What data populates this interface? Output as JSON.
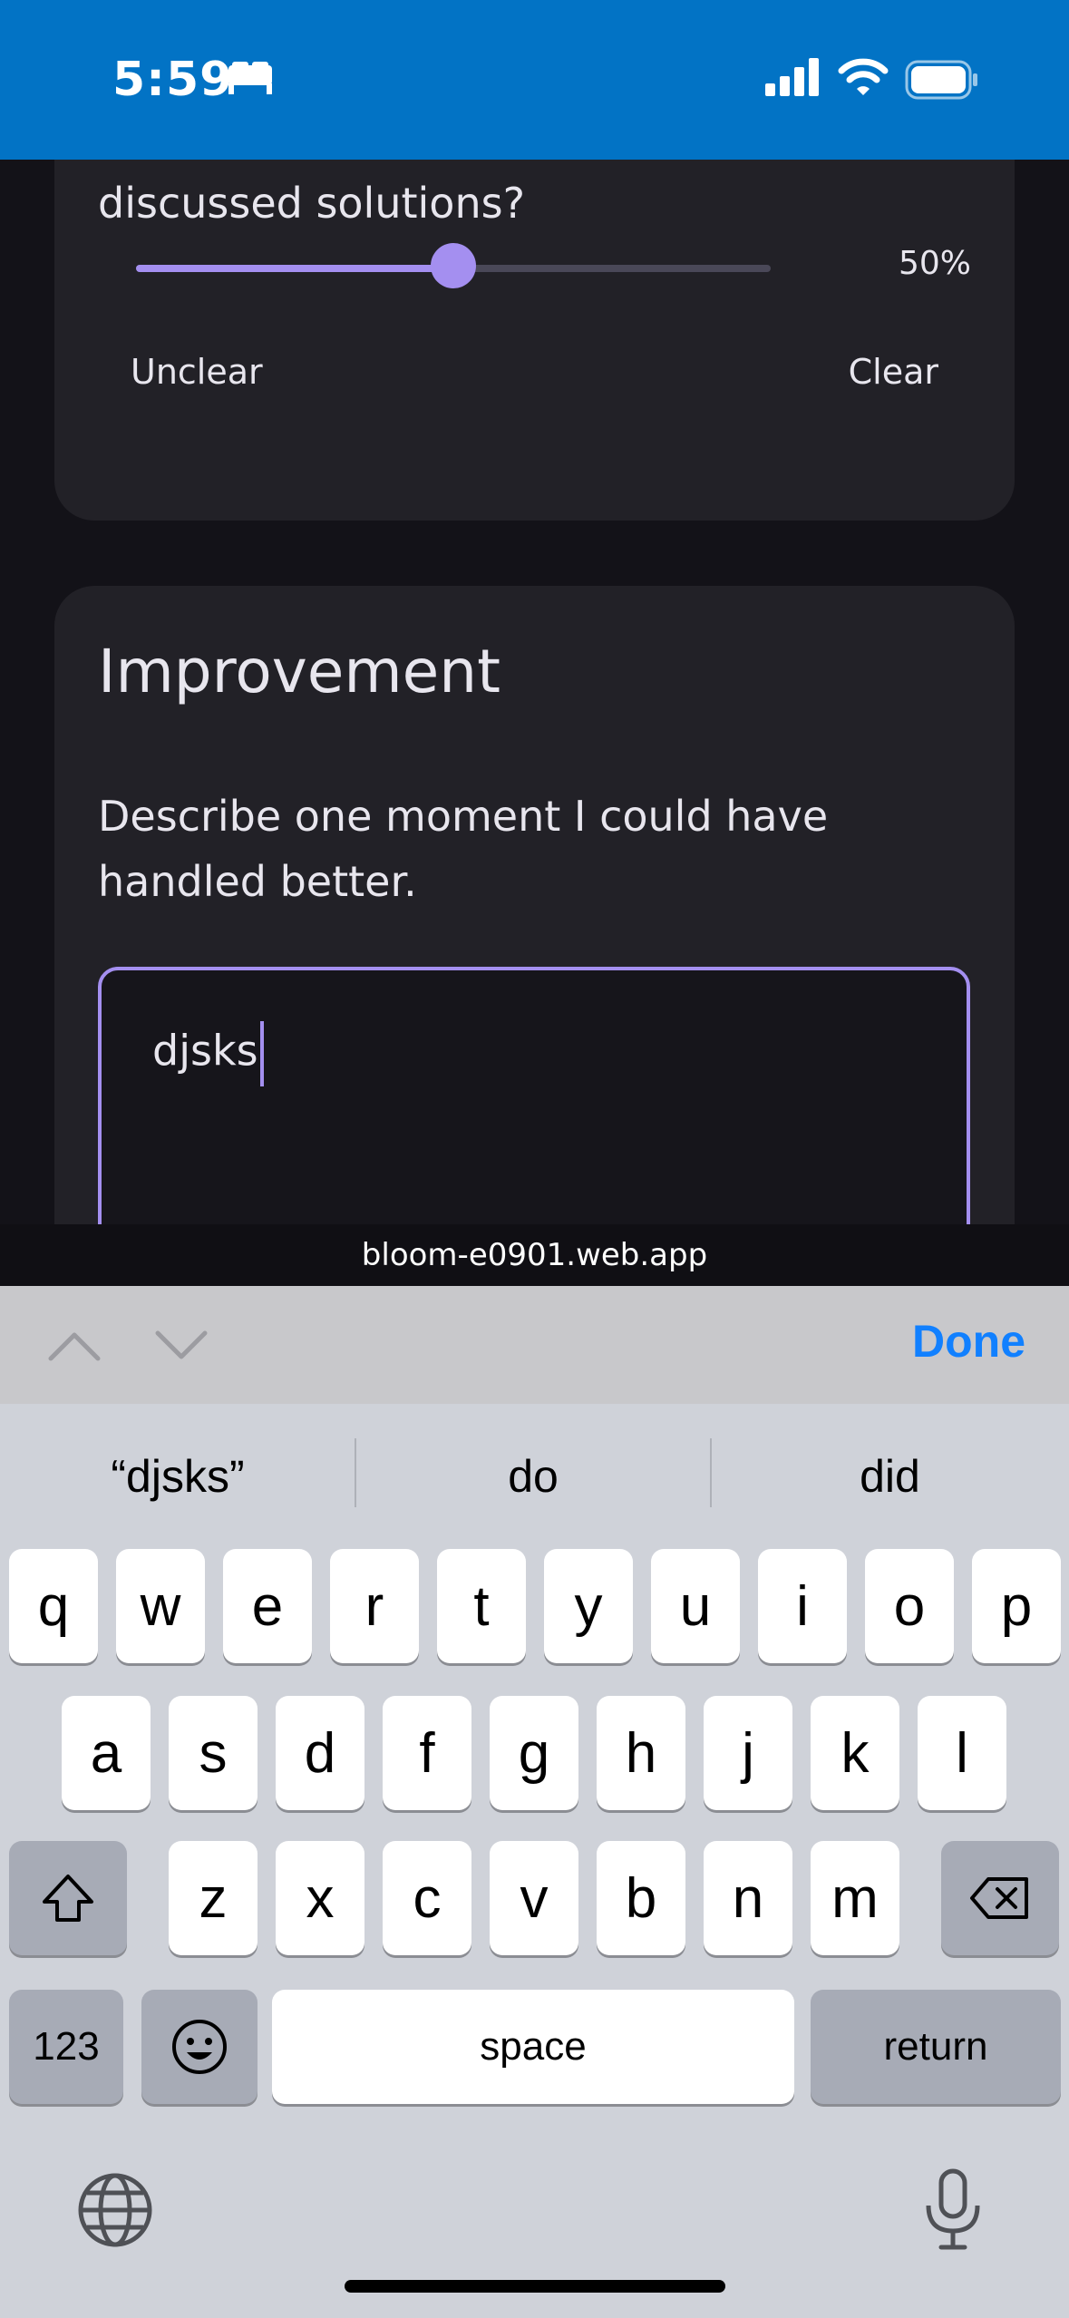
{
  "status_bar": {
    "time": "5:59",
    "icons": [
      "sleep-icon",
      "signal-icon",
      "wifi-icon",
      "battery-icon"
    ]
  },
  "clarity_card": {
    "question_tail": "discussed solutions?",
    "slider": {
      "value_fraction": 0.5,
      "value_label": "50%",
      "min_label": "Unclear",
      "max_label": "Clear"
    }
  },
  "improvement_card": {
    "title": "Improvement",
    "question": "Describe one moment I could have handled better.",
    "answer_value": "djsks"
  },
  "url_bar": {
    "url": "bloom-e0901.web.app"
  },
  "accessory_bar": {
    "done_label": "Done"
  },
  "keyboard": {
    "suggestions": [
      "“djsks”",
      "do",
      "did"
    ],
    "row1": [
      "q",
      "w",
      "e",
      "r",
      "t",
      "y",
      "u",
      "i",
      "o",
      "p"
    ],
    "row2": [
      "a",
      "s",
      "d",
      "f",
      "g",
      "h",
      "j",
      "k",
      "l"
    ],
    "row3": [
      "z",
      "x",
      "c",
      "v",
      "b",
      "n",
      "m"
    ],
    "numbers_label": "123",
    "space_label": "space",
    "return_label": "return"
  },
  "colors": {
    "accent": "#a48ff0",
    "status_bar": "#0273c5",
    "done": "#1180ff",
    "card": "#222127"
  }
}
